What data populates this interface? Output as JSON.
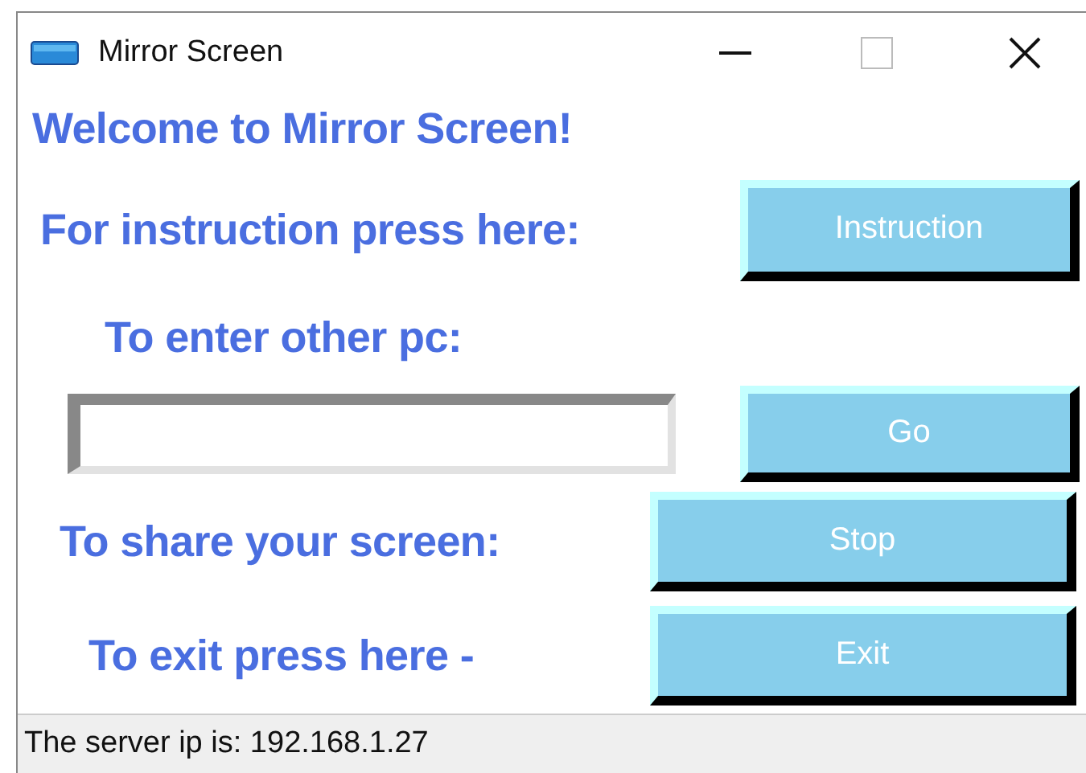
{
  "window": {
    "title": "Mirror Screen"
  },
  "welcome": "Welcome to Mirror Screen!",
  "instruction": {
    "label": "For instruction press here:",
    "button": "Instruction"
  },
  "enter": {
    "label": "To enter other pc:",
    "button": "Go"
  },
  "share": {
    "label": "To share your screen:",
    "button": "Stop"
  },
  "exit": {
    "label": "To exit press here -",
    "button": "Exit"
  },
  "status_bar": "The server ip is: 192.168.1.27"
}
